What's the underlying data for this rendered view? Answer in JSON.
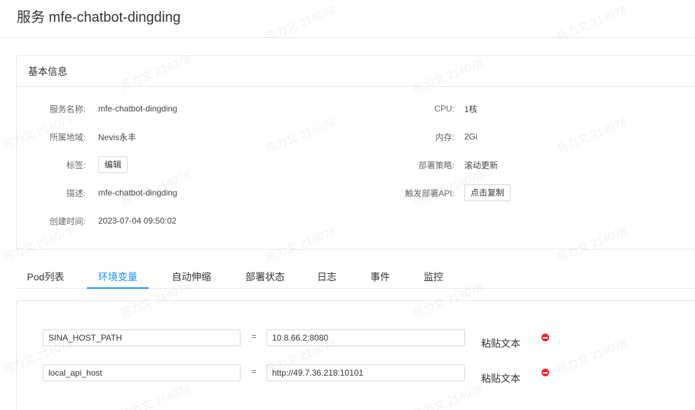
{
  "page": {
    "title": "服务 mfe-chatbot-dingding"
  },
  "basic_info": {
    "card_title": "基本信息",
    "left": [
      {
        "label": "服务名称:",
        "value": "mfe-chatbot-dingding"
      },
      {
        "label": "所属地域:",
        "value": "Nevis永丰"
      },
      {
        "label": "标签:",
        "button": "编辑"
      },
      {
        "label": "描述:",
        "value": "mfe-chatbot-dingding"
      },
      {
        "label": "创建时间:",
        "value": "2023-07-04 09:50:02"
      }
    ],
    "right": [
      {
        "label": "CPU:",
        "value": "1核"
      },
      {
        "label": "内存:",
        "value": "2Gi"
      },
      {
        "label": "部署策略:",
        "value": "滚动更新"
      },
      {
        "label": "触发部署API:",
        "button": "点击复制"
      }
    ]
  },
  "tabs": [
    {
      "label": "Pod列表",
      "active": false
    },
    {
      "label": "环境变量",
      "active": true
    },
    {
      "label": "自动伸缩",
      "active": false
    },
    {
      "label": "部署状态",
      "active": false
    },
    {
      "label": "日志",
      "active": false
    },
    {
      "label": "事件",
      "active": false
    },
    {
      "label": "监控",
      "active": false
    }
  ],
  "env_vars": [
    {
      "key": "SINA_HOST_PATH",
      "equals": "=",
      "value": "10.8.66.2:8080",
      "paste_label": "粘贴文本",
      "remove_icon": "minus-circle-icon"
    },
    {
      "key": "local_api_host",
      "equals": "=",
      "value": "http://49.7.36.218:10101",
      "paste_label": "粘贴文本",
      "remove_icon": "minus-circle-icon"
    }
  ],
  "watermark": {
    "text": "苑力文 214078"
  },
  "colors": {
    "accent": "#1890ff",
    "danger": "#f5222d",
    "border": "#e8e8e8"
  }
}
